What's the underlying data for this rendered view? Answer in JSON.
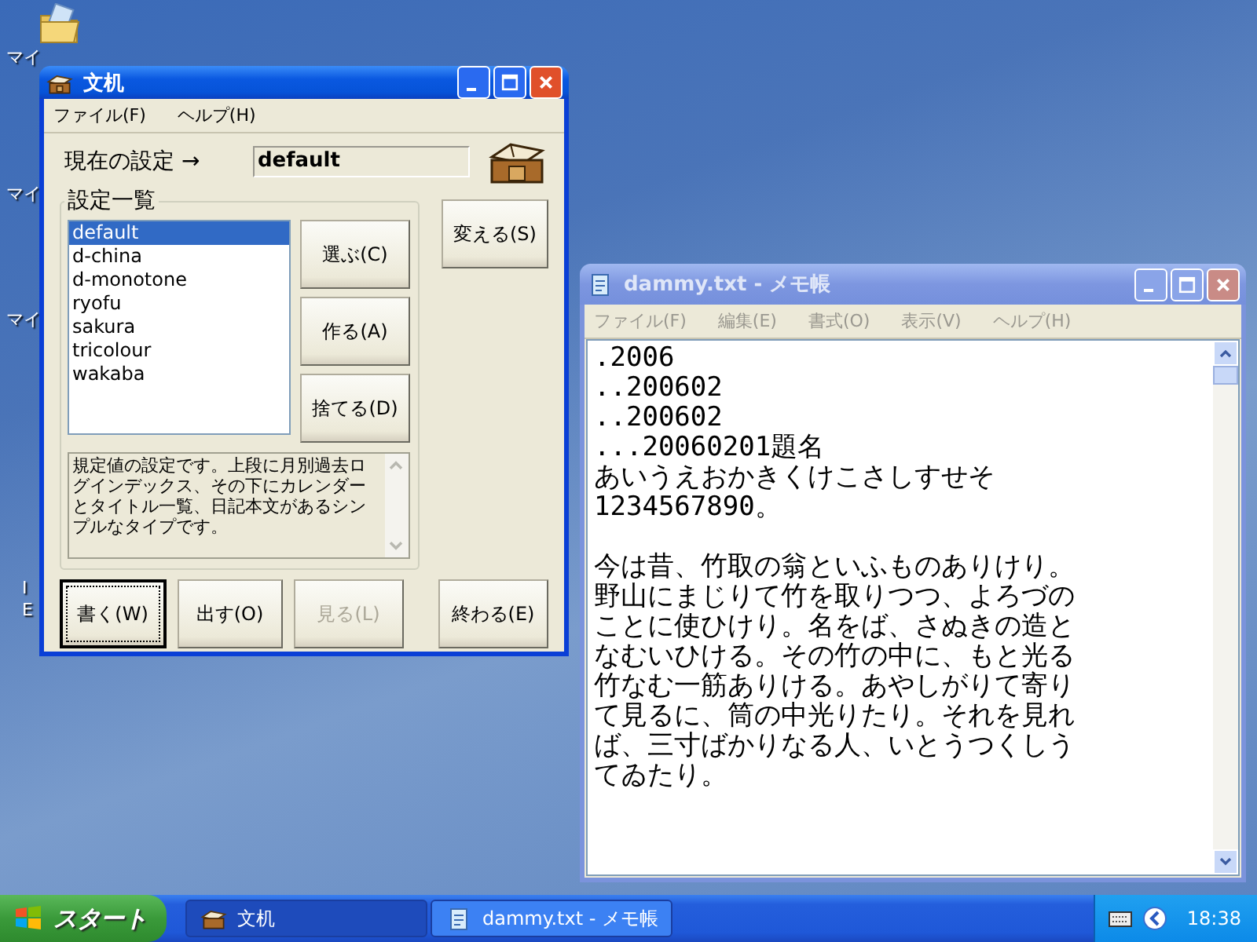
{
  "desktop": {
    "labels": [
      {
        "text": "マイ",
        "kind": "folder"
      },
      {
        "text": "マイ",
        "kind": "plain"
      },
      {
        "text": "マイ",
        "kind": "plain"
      },
      {
        "text": "I\nE",
        "kind": "plain"
      }
    ]
  },
  "main_window": {
    "title": "文机",
    "active": true,
    "menu": [
      "ファイル(F)",
      "ヘルプ(H)"
    ],
    "current_label": "現在の設定 →",
    "current_value": "default",
    "group_title": "設定一覧",
    "list": [
      {
        "label": "default",
        "selected": true
      },
      {
        "label": "d-china",
        "selected": false
      },
      {
        "label": "d-monotone",
        "selected": false
      },
      {
        "label": "ryofu",
        "selected": false
      },
      {
        "label": "sakura",
        "selected": false
      },
      {
        "label": "tricolour",
        "selected": false
      },
      {
        "label": "wakaba",
        "selected": false
      }
    ],
    "side_buttons": [
      {
        "label": "選ぶ(C)",
        "disabled": false
      },
      {
        "label": "作る(A)",
        "disabled": false
      },
      {
        "label": "捨てる(D)",
        "disabled": false
      }
    ],
    "change_button": {
      "label": "変える(S)",
      "disabled": false
    },
    "description": "規定値の設定です。上段に月別過去ログインデックス、その下にカレンダーとタイトル一覧、日記本文があるシンプルなタイプです。",
    "bottom_buttons": [
      {
        "label": "書く(W)",
        "disabled": false,
        "focused": true
      },
      {
        "label": "出す(O)",
        "disabled": false,
        "focused": false
      },
      {
        "label": "見る(L)",
        "disabled": true,
        "focused": false
      }
    ],
    "exit_button": {
      "label": "終わる(E)",
      "disabled": false,
      "focused": false
    }
  },
  "notepad": {
    "title": "dammy.txt - メモ帳",
    "active": false,
    "menu": [
      "ファイル(F)",
      "編集(E)",
      "書式(O)",
      "表示(V)",
      "ヘルプ(H)"
    ],
    "paragraphs": [
      [
        ".2006",
        "..200602",
        "..200602",
        "...20060201題名",
        "あいうえおかきくけこさしすせそ",
        "1234567890。"
      ],
      [
        "今は昔、竹取の翁といふものありけり。",
        "野山にまじりて竹を取りつつ、よろづの",
        "ことに使ひけり。名をば、さぬきの造と",
        "なむいひける。その竹の中に、もと光る",
        "竹なむ一筋ありける。あやしがりて寄り",
        "て見るに、筒の中光りたり。それを見れ",
        "ば、三寸ばかりなる人、いとうつくしう",
        "てゐたり。"
      ]
    ]
  },
  "taskbar": {
    "start": "スタート",
    "tasks": [
      {
        "label": "文机",
        "selected": true,
        "kind": "desk"
      },
      {
        "label": "dammy.txt - メモ帳",
        "selected": false,
        "kind": "notepad"
      }
    ],
    "clock": "18:38"
  }
}
